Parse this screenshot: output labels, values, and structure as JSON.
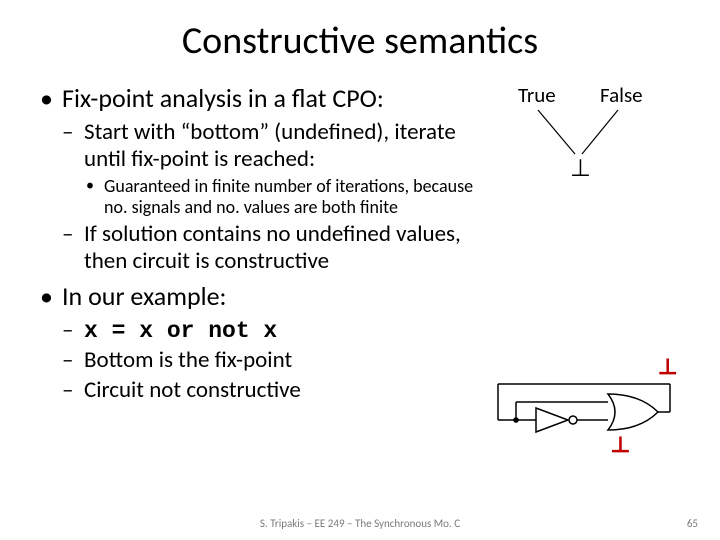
{
  "title": "Constructive semantics",
  "bullets": {
    "b1": "Fix-point analysis in a flat CPO:",
    "b1s1": "Start with “bottom” (undefined), iterate until fix-point is reached:",
    "b1s1s1": "Guaranteed in finite number of iterations, because no. signals and no. values are both finite",
    "b1s2": "If solution contains no undefined values, then circuit is constructive",
    "b2": "In our example:",
    "b2s1": "x = x or not x",
    "b2s2": "Bottom is the fix-point",
    "b2s3": "Circuit not constructive"
  },
  "cpo": {
    "true_label": "True",
    "false_label": "False",
    "bottom": "⊥"
  },
  "circuit": {
    "bot1": "⊥",
    "bot2": "⊥"
  },
  "footer": "S. Tripakis – EE 249 – The Synchronous Mo. C",
  "pagenum": "65"
}
